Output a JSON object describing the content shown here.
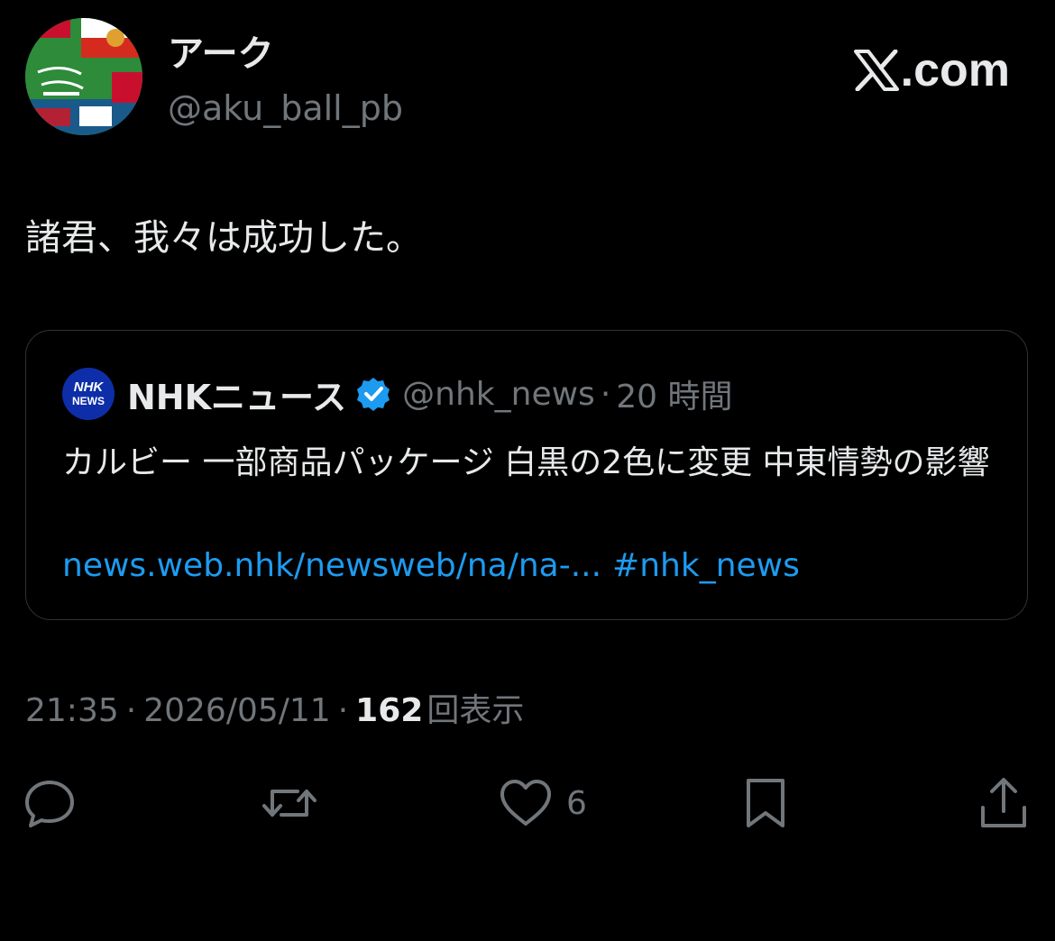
{
  "author": {
    "name": "アーク",
    "handle": "@aku_ball_pb"
  },
  "brand": {
    "site": ".com",
    "logo_icon": "x-logo-icon"
  },
  "tweet": {
    "text": "諸君、我々は成功した。"
  },
  "quote": {
    "logo_line1": "NHK",
    "logo_line2": "NEWS",
    "name": "NHKニュース",
    "handle": "@nhk_news",
    "separator": "·",
    "time": "20 時間",
    "text": "カルビー 一部商品パッケージ 白黒の2色に変更 中東情勢の影響",
    "link": "news.web.nhk/newsweb/na/na-...",
    "hashtag": "#nhk_news"
  },
  "meta": {
    "time": "21:35",
    "dot": "·",
    "date": "2026/05/11",
    "views_count": "162",
    "views_label": "回表示"
  },
  "actions": {
    "reply_icon": "reply-icon",
    "retweet_icon": "retweet-icon",
    "like_icon": "heart-icon",
    "like_count": "6",
    "bookmark_icon": "bookmark-icon",
    "share_icon": "share-icon"
  },
  "colors": {
    "background": "#000000",
    "text": "#e7e9ea",
    "secondary": "#71767b",
    "link": "#1d9bf0",
    "border": "#2f3336",
    "nhk_blue": "#0d2ea8"
  }
}
